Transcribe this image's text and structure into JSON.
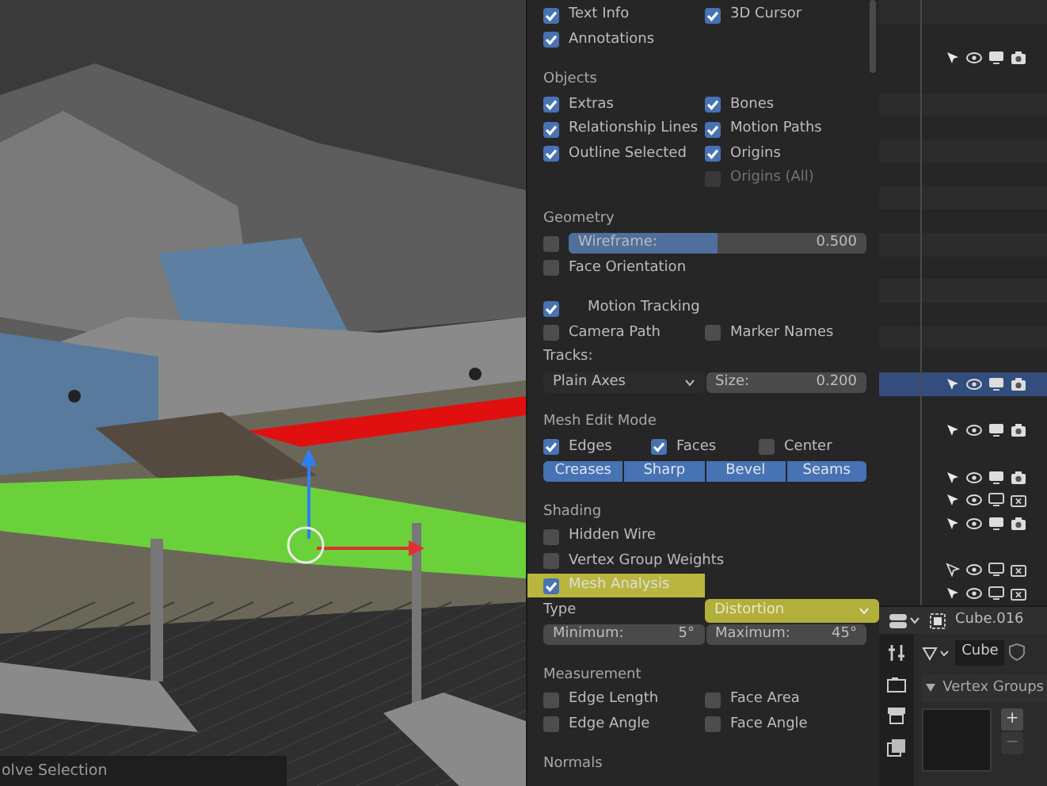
{
  "viewport": {
    "status_text": "olve Selection"
  },
  "overlays": {
    "rows": [
      {
        "kind": "checks",
        "items": [
          {
            "label": "Text Info",
            "checked": true
          },
          {
            "label": "3D Cursor",
            "checked": true
          }
        ]
      },
      {
        "kind": "checks",
        "items": [
          {
            "label": "Annotations",
            "checked": true
          }
        ]
      },
      {
        "kind": "heading",
        "text": "Objects"
      },
      {
        "kind": "checks",
        "items": [
          {
            "label": "Extras",
            "checked": true
          },
          {
            "label": "Bones",
            "checked": true
          }
        ]
      },
      {
        "kind": "checks",
        "items": [
          {
            "label": "Relationship Lines",
            "checked": true
          },
          {
            "label": "Motion Paths",
            "checked": true
          }
        ]
      },
      {
        "kind": "checks",
        "items": [
          {
            "label": "Outline Selected",
            "checked": true
          },
          {
            "label": "Origins",
            "checked": true
          }
        ]
      },
      {
        "kind": "checks_right",
        "items": [
          {
            "label": "Origins (All)",
            "checked": false,
            "disabled": true
          }
        ]
      },
      {
        "kind": "heading",
        "text": "Geometry"
      },
      {
        "kind": "slider",
        "checked": false,
        "label": "Wireframe:",
        "value": "0.500",
        "level": 0.5
      },
      {
        "kind": "checks",
        "items": [
          {
            "label": "Face Orientation",
            "checked": false
          }
        ]
      },
      {
        "kind": "subpanel",
        "label": "Motion Tracking",
        "checked": true
      },
      {
        "kind": "checks",
        "items": [
          {
            "label": "Camera Path",
            "checked": false
          },
          {
            "label": "Marker Names",
            "checked": false
          }
        ]
      },
      {
        "kind": "label",
        "text": "Tracks:"
      },
      {
        "kind": "dropdown_field",
        "dropdown": "Plain Axes",
        "field_label": "Size:",
        "value": "0.200"
      },
      {
        "kind": "heading",
        "text": "Mesh Edit Mode"
      },
      {
        "kind": "checks",
        "items": [
          {
            "label": "Edges",
            "checked": true
          },
          {
            "label": "Faces",
            "checked": true
          },
          {
            "label": "Center",
            "checked": false
          }
        ]
      },
      {
        "kind": "buttons",
        "items": [
          {
            "label": "Creases",
            "selected": true
          },
          {
            "label": "Sharp",
            "selected": true
          },
          {
            "label": "Bevel",
            "selected": true
          },
          {
            "label": "Seams",
            "selected": true
          }
        ]
      },
      {
        "kind": "heading",
        "text": "Shading"
      },
      {
        "kind": "checks",
        "items": [
          {
            "label": "Hidden Wire",
            "checked": false
          }
        ]
      },
      {
        "kind": "checks",
        "items": [
          {
            "label": "Vertex Group Weights",
            "checked": false
          }
        ]
      },
      {
        "kind": "checks",
        "items": [
          {
            "label": "Mesh Analysis",
            "checked": true,
            "highlighted": true
          }
        ]
      },
      {
        "kind": "select",
        "label": "Type",
        "value": "Distortion",
        "highlighted": true
      },
      {
        "kind": "fields",
        "items": [
          {
            "label": "Minimum:",
            "value": "5°"
          },
          {
            "label": "Maximum:",
            "value": "45°"
          }
        ]
      },
      {
        "kind": "heading",
        "text": "Measurement"
      },
      {
        "kind": "checks",
        "items": [
          {
            "label": "Edge Length",
            "checked": false
          },
          {
            "label": "Face Area",
            "checked": false
          }
        ]
      },
      {
        "kind": "checks",
        "items": [
          {
            "label": "Edge Angle",
            "checked": false
          },
          {
            "label": "Face Angle",
            "checked": false
          }
        ]
      },
      {
        "kind": "heading",
        "text": "Normals"
      }
    ]
  },
  "outliner": {
    "rows": [
      {
        "kind": "blank"
      },
      {
        "kind": "blank"
      },
      {
        "kind": "object",
        "active": false,
        "selectable": true,
        "viewport": true,
        "render": true
      },
      {
        "kind": "blank"
      },
      {
        "kind": "blank"
      },
      {
        "kind": "blank"
      },
      {
        "kind": "blank"
      },
      {
        "kind": "blank"
      },
      {
        "kind": "blank"
      },
      {
        "kind": "blank"
      },
      {
        "kind": "blank"
      },
      {
        "kind": "blank"
      },
      {
        "kind": "blank"
      },
      {
        "kind": "blank"
      },
      {
        "kind": "blank"
      },
      {
        "kind": "blank"
      },
      {
        "kind": "object",
        "active": true,
        "selectable": true,
        "viewport": true,
        "render": true
      },
      {
        "kind": "blank"
      },
      {
        "kind": "object",
        "active": false,
        "selectable": true,
        "viewport": true,
        "render": true
      },
      {
        "kind": "blank"
      },
      {
        "kind": "object",
        "active": false,
        "selectable": true,
        "viewport": true,
        "render": true
      },
      {
        "kind": "object",
        "active": false,
        "selectable": true,
        "viewport": false,
        "render": false
      },
      {
        "kind": "object",
        "active": false,
        "selectable": true,
        "viewport": true,
        "render": true
      },
      {
        "kind": "blank"
      },
      {
        "kind": "object",
        "active": false,
        "selectable": false,
        "viewport": false,
        "render": false
      },
      {
        "kind": "object",
        "active": false,
        "selectable": true,
        "viewport": false,
        "render": false
      }
    ]
  },
  "properties": {
    "object_name": "Cube.016",
    "mesh_name": "Cube",
    "panel_title": "Vertex Groups",
    "panel_expanded": true,
    "buttons": [
      {
        "label": "+",
        "disabled": false
      },
      {
        "label": "−",
        "disabled": true
      }
    ]
  }
}
